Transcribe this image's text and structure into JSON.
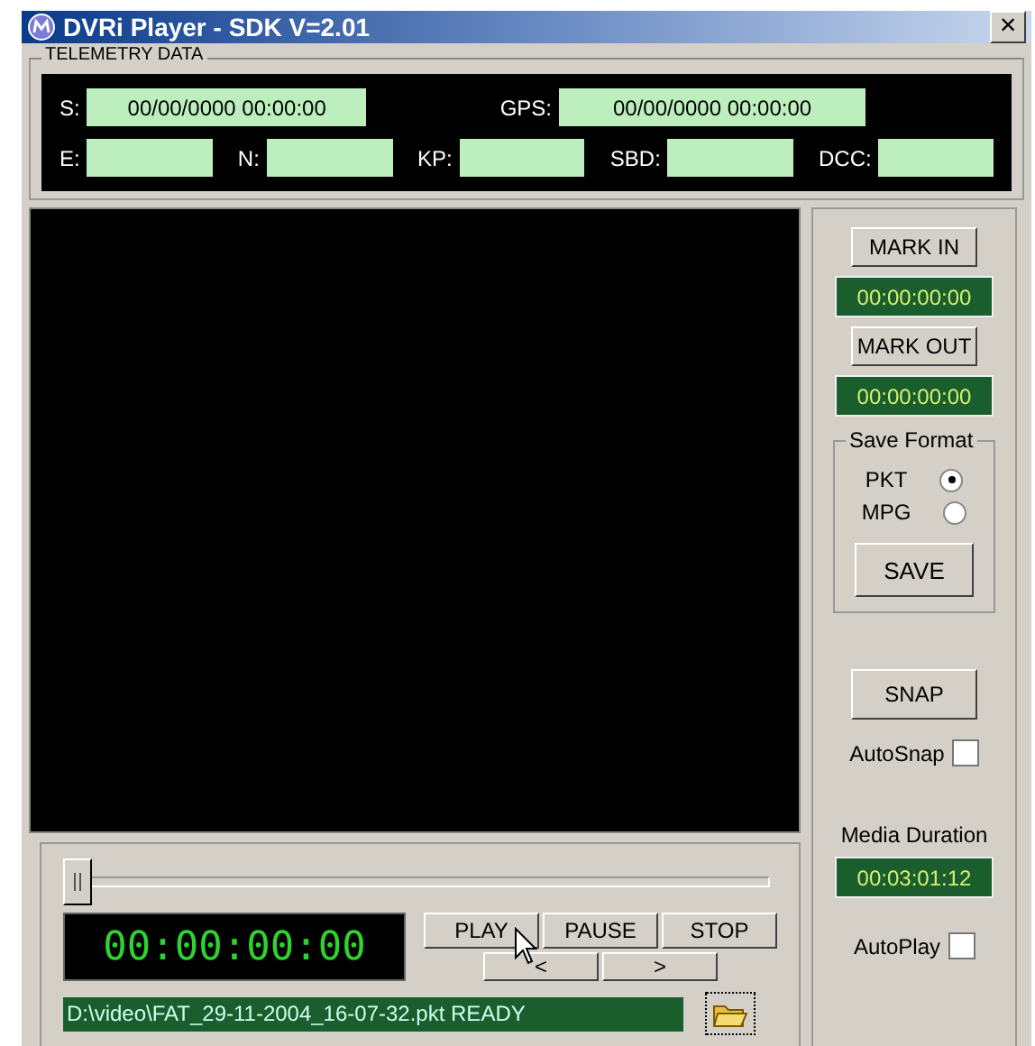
{
  "window": {
    "title": "DVRi Player - SDK V=2.01",
    "close": "×"
  },
  "telemetry": {
    "title": "TELEMETRY DATA",
    "top": [
      {
        "label": "S:",
        "value": "00/00/0000 00:00:00"
      },
      {
        "label": "GPS:",
        "value": "00/00/0000 00:00:00"
      }
    ],
    "bottom": [
      {
        "label": "E:"
      },
      {
        "label": "N:"
      },
      {
        "label": "KP:"
      },
      {
        "label": "SBD:"
      },
      {
        "label": "DCC:"
      }
    ]
  },
  "side": {
    "mark_in": "MARK IN",
    "mark_in_time": "00:00:00:00",
    "mark_out": "MARK OUT",
    "mark_out_time": "00:00:00:00",
    "save_format": {
      "title": "Save Format",
      "options": [
        {
          "label": "PKT",
          "selected": true
        },
        {
          "label": "MPG",
          "selected": false
        }
      ],
      "save": "SAVE"
    },
    "snap": "SNAP",
    "autosnap": {
      "label": "AutoSnap",
      "checked": false
    },
    "media_duration_label": "Media Duration",
    "media_duration": "00:03:01:12",
    "autoplay": {
      "label": "AutoPlay",
      "checked": false
    }
  },
  "controls": {
    "seek": {
      "level": 0
    },
    "timecode": "00:00:00:00",
    "buttons": [
      "PLAY",
      "PAUSE",
      "STOP"
    ],
    "step": [
      "<",
      ">"
    ],
    "status": "D:\\video\\FAT_29-11-2004_16-07-32.pkt  READY"
  }
}
